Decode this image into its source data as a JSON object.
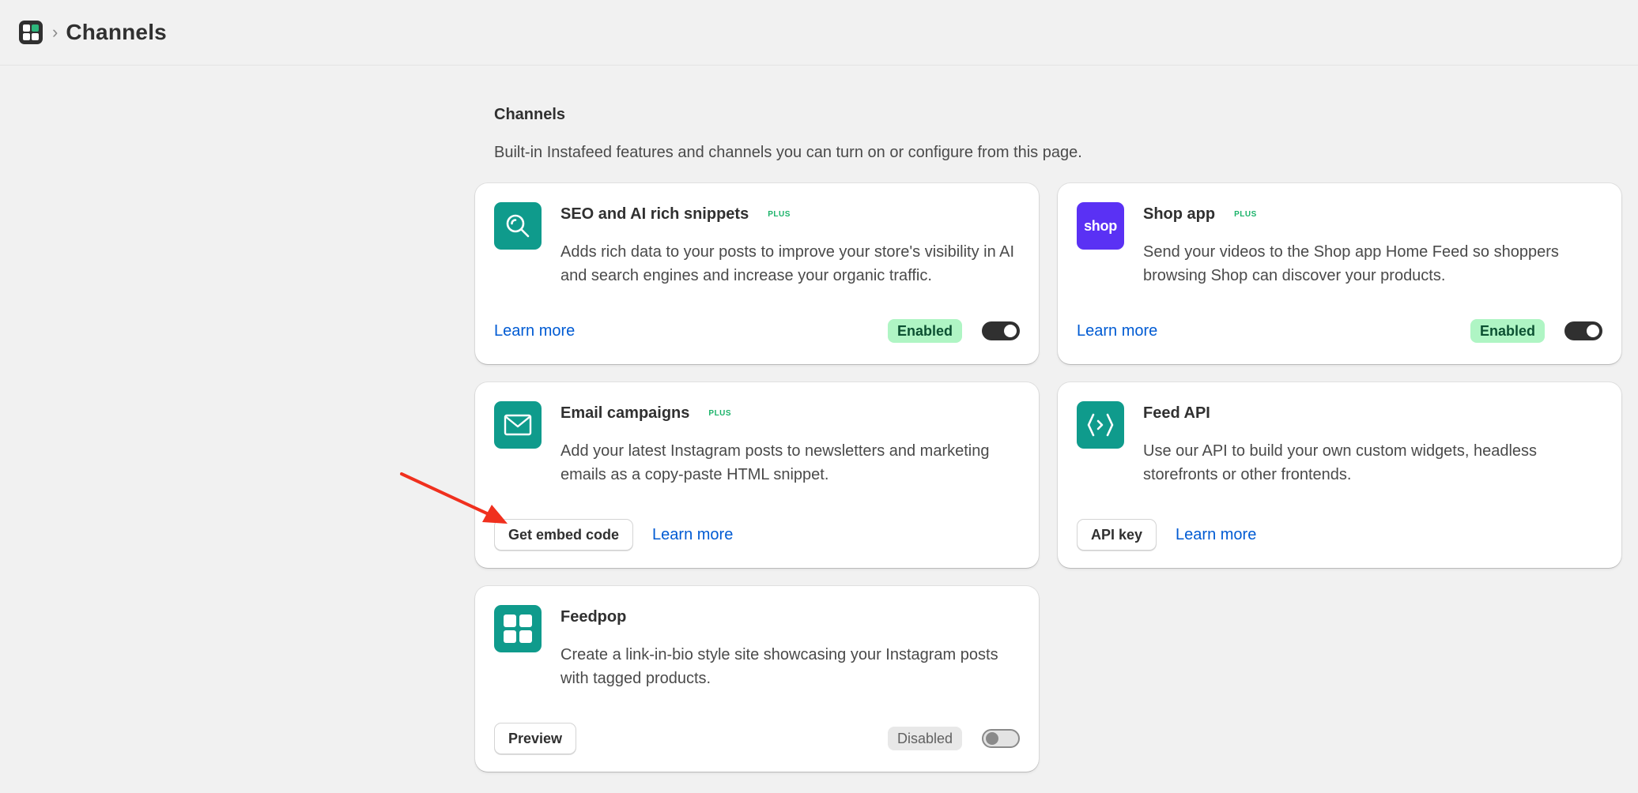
{
  "header": {
    "breadcrumb_separator": "›",
    "title": "Channels"
  },
  "section": {
    "title": "Channels",
    "description": "Built-in Instafeed features and channels you can turn on or configure from this page."
  },
  "cards": [
    {
      "title": "SEO and AI rich snippets",
      "badge": "PLUS",
      "description": "Adds rich data to your posts to improve your store's visibility in AI and search engines and increase your organic traffic.",
      "link": "Learn more",
      "status": "Enabled",
      "toggle_on": true,
      "icon": "search-icon",
      "icon_color": "#0f9b8c"
    },
    {
      "title": "Shop app",
      "badge": "PLUS",
      "description": "Send your videos to the Shop app Home Feed so shoppers browsing Shop can discover your products.",
      "link": "Learn more",
      "status": "Enabled",
      "toggle_on": true,
      "icon": "shop-logo-icon",
      "icon_text": "shop",
      "icon_color": "#5a31f4"
    },
    {
      "title": "Email campaigns",
      "badge": "PLUS",
      "description": "Add your latest Instagram posts to newsletters and marketing emails as a copy-paste HTML snippet.",
      "button": "Get embed code",
      "link": "Learn more",
      "icon": "mail-icon",
      "icon_color": "#0f9b8c"
    },
    {
      "title": "Feed API",
      "description": "Use our API to build your own custom widgets, headless storefronts or other frontends.",
      "button": "API key",
      "link": "Learn more",
      "icon": "code-icon",
      "icon_color": "#0f9b8c"
    },
    {
      "title": "Feedpop",
      "description": "Create a link-in-bio style site showcasing your Instagram posts with tagged products.",
      "button": "Preview",
      "status": "Disabled",
      "toggle_on": false,
      "icon": "grid-icon",
      "icon_color": "#0f9b8c"
    }
  ],
  "colors": {
    "accent_link": "#005bd3",
    "enabled_badge": "#aff5c4",
    "plus_badge": "#1bb36a",
    "annotation_arrow": "#f0301e"
  }
}
